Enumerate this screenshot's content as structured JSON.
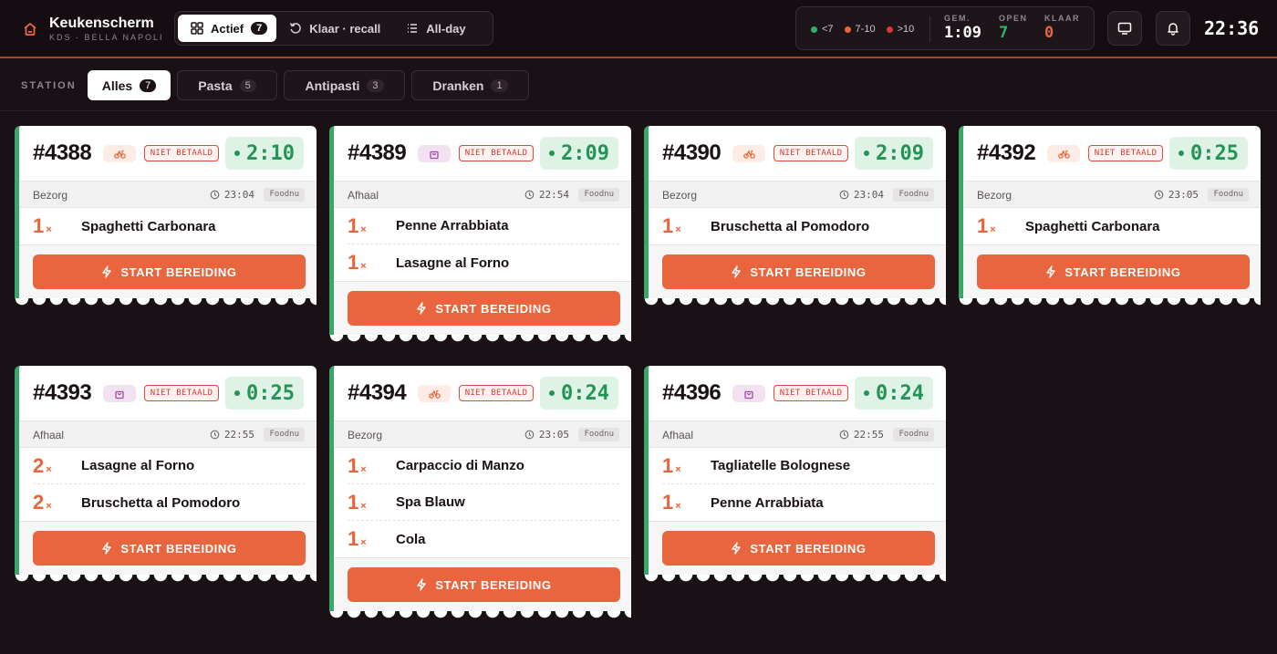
{
  "brand": {
    "title": "Keukenscherm",
    "subtitle": "KDS · BELLA NAPOLI"
  },
  "nav": {
    "active": {
      "label": "Actief",
      "count": "7"
    },
    "recall": {
      "label": "Klaar · recall"
    },
    "allday": {
      "label": "All-day"
    }
  },
  "stats": {
    "legend": [
      "<7",
      "7-10",
      ">10"
    ],
    "avg": {
      "label": "GEM.",
      "value": "1:09"
    },
    "open": {
      "label": "OPEN",
      "value": "7"
    },
    "done": {
      "label": "KLAAR",
      "value": "0"
    }
  },
  "clock": "22:36",
  "stations": {
    "label": "STATION",
    "filters": [
      {
        "label": "Alles",
        "count": "7"
      },
      {
        "label": "Pasta",
        "count": "5"
      },
      {
        "label": "Antipasti",
        "count": "3"
      },
      {
        "label": "Dranken",
        "count": "1"
      }
    ]
  },
  "colors": {
    "accent": "#e8653e",
    "ok": "#239455",
    "bg": "#1a1116"
  },
  "tickets": [
    {
      "number": "#4388",
      "type_icon": "bike-icon",
      "paid": "NIET BETAALD",
      "timer": "2:10",
      "mode": "Bezorg",
      "time": "23:04",
      "source": "Foodnu",
      "items": [
        {
          "qty": "1",
          "x": "×",
          "name": "Spaghetti Carbonara"
        }
      ],
      "button": "START BEREIDING"
    },
    {
      "number": "#4389",
      "type_icon": "bag-icon",
      "paid": "NIET BETAALD",
      "timer": "2:09",
      "mode": "Afhaal",
      "time": "22:54",
      "source": "Foodnu",
      "items": [
        {
          "qty": "1",
          "x": "×",
          "name": "Penne Arrabbiata"
        },
        {
          "qty": "1",
          "x": "×",
          "name": "Lasagne al Forno"
        }
      ],
      "button": "START BEREIDING"
    },
    {
      "number": "#4390",
      "type_icon": "bike-icon",
      "paid": "NIET BETAALD",
      "timer": "2:09",
      "mode": "Bezorg",
      "time": "23:04",
      "source": "Foodnu",
      "items": [
        {
          "qty": "1",
          "x": "×",
          "name": "Bruschetta al Pomodoro"
        }
      ],
      "button": "START BEREIDING"
    },
    {
      "number": "#4392",
      "type_icon": "bike-icon",
      "paid": "NIET BETAALD",
      "timer": "0:25",
      "mode": "Bezorg",
      "time": "23:05",
      "source": "Foodnu",
      "items": [
        {
          "qty": "1",
          "x": "×",
          "name": "Spaghetti Carbonara"
        }
      ],
      "button": "START BEREIDING"
    },
    {
      "number": "#4393",
      "type_icon": "bag-icon",
      "paid": "NIET BETAALD",
      "timer": "0:25",
      "mode": "Afhaal",
      "time": "22:55",
      "source": "Foodnu",
      "items": [
        {
          "qty": "2",
          "x": "×",
          "name": "Lasagne al Forno"
        },
        {
          "qty": "2",
          "x": "×",
          "name": "Bruschetta al Pomodoro"
        }
      ],
      "button": "START BEREIDING"
    },
    {
      "number": "#4394",
      "type_icon": "bike-icon",
      "paid": "NIET BETAALD",
      "timer": "0:24",
      "mode": "Bezorg",
      "time": "23:05",
      "source": "Foodnu",
      "items": [
        {
          "qty": "1",
          "x": "×",
          "name": "Carpaccio di Manzo"
        },
        {
          "qty": "1",
          "x": "×",
          "name": "Spa Blauw"
        },
        {
          "qty": "1",
          "x": "×",
          "name": "Cola"
        }
      ],
      "button": "START BEREIDING"
    },
    {
      "number": "#4396",
      "type_icon": "bag-icon",
      "paid": "NIET BETAALD",
      "timer": "0:24",
      "mode": "Afhaal",
      "time": "22:55",
      "source": "Foodnu",
      "items": [
        {
          "qty": "1",
          "x": "×",
          "name": "Tagliatelle Bolognese"
        },
        {
          "qty": "1",
          "x": "×",
          "name": "Penne Arrabbiata"
        }
      ],
      "button": "START BEREIDING"
    }
  ]
}
